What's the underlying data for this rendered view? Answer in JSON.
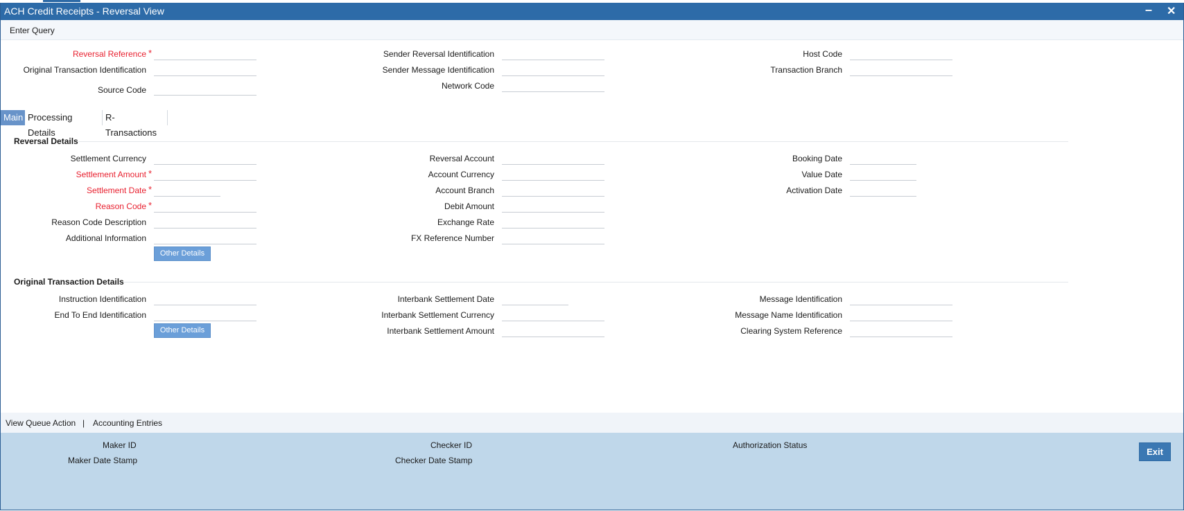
{
  "window": {
    "title": "ACH Credit Receipts - Reversal View",
    "minimize_icon": "minimize-icon",
    "close_icon": "close-icon"
  },
  "menu": {
    "enter_query": "Enter Query"
  },
  "header": {
    "reversal_reference": "Reversal Reference",
    "original_transaction_identification": "Original Transaction Identification",
    "source_code": "Source Code",
    "sender_reversal_identification": "Sender Reversal Identification",
    "sender_message_identification": "Sender Message Identification",
    "network_code": "Network Code",
    "host_code": "Host Code",
    "transaction_branch": "Transaction Branch",
    "required_marker": "*"
  },
  "tabs": [
    "Main",
    "Processing Details",
    "R-Transactions"
  ],
  "reversal_details": {
    "title": "Reversal Details",
    "settlement_currency": "Settlement Currency",
    "settlement_amount": "Settlement Amount",
    "settlement_date": "Settlement Date",
    "reason_code": "Reason Code",
    "reason_code_description": "Reason Code Description",
    "additional_information": "Additional Information",
    "other_details": "Other Details",
    "reversal_account": "Reversal Account",
    "account_currency": "Account Currency",
    "account_branch": "Account Branch",
    "debit_amount": "Debit Amount",
    "exchange_rate": "Exchange Rate",
    "fx_reference_number": "FX Reference Number",
    "booking_date": "Booking Date",
    "value_date": "Value Date",
    "activation_date": "Activation Date"
  },
  "original_transaction_details": {
    "title": "Original Transaction Details",
    "instruction_identification": "Instruction Identification",
    "end_to_end_identification": "End To End Identification",
    "other_details": "Other Details",
    "interbank_settlement_date": "Interbank Settlement Date",
    "interbank_settlement_currency": "Interbank Settlement Currency",
    "interbank_settlement_amount": "Interbank Settlement Amount",
    "message_identification": "Message Identification",
    "message_name_identification": "Message Name Identification",
    "clearing_system_reference": "Clearing System Reference"
  },
  "actions": {
    "view_queue_action": "View Queue Action",
    "separator": "|",
    "accounting_entries": "Accounting Entries"
  },
  "footer": {
    "maker_id": "Maker ID",
    "maker_date_stamp": "Maker Date Stamp",
    "checker_id": "Checker ID",
    "checker_date_stamp": "Checker Date Stamp",
    "authorization_status": "Authorization Status",
    "exit": "Exit"
  },
  "colors": {
    "titlebar": "#2d6ba8",
    "required": "#e8202f",
    "active_tab": "#6893c9",
    "button": "#6b9fd9",
    "footer": "#bfd7ea",
    "exit_button": "#3b78b3"
  }
}
